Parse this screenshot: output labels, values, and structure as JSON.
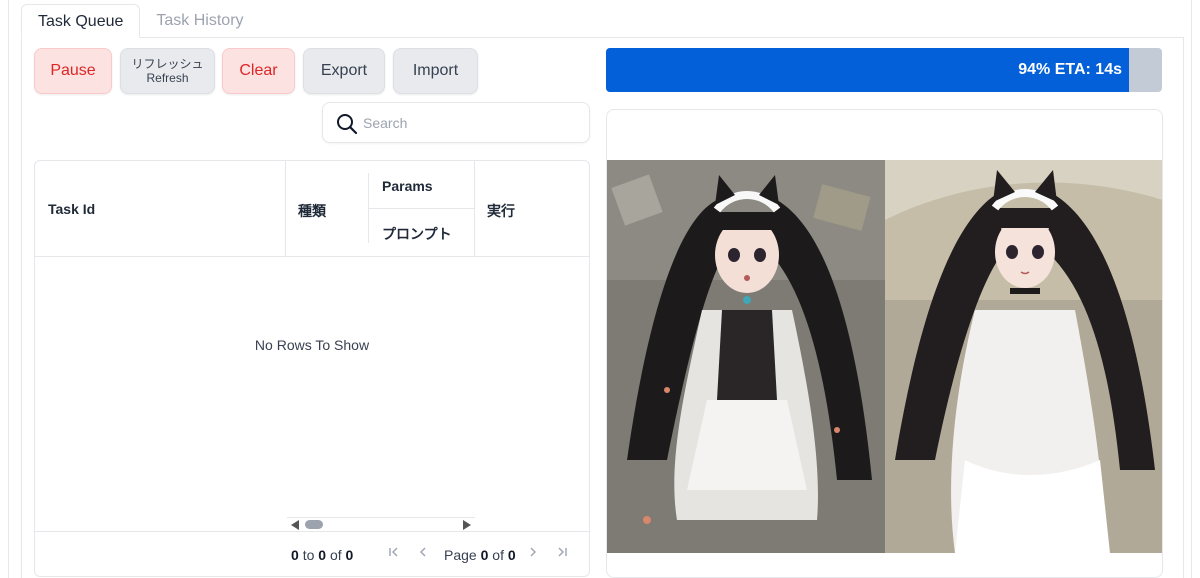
{
  "tabs": [
    {
      "label": "Task Queue",
      "active": true
    },
    {
      "label": "Task History",
      "active": false
    }
  ],
  "toolbar": {
    "pause_label": "Pause",
    "refresh_label_jp": "リフレッシュ",
    "refresh_label_en": "Refresh",
    "clear_label": "Clear",
    "export_label": "Export",
    "import_label": "Import"
  },
  "search": {
    "placeholder": "Search",
    "value": ""
  },
  "grid": {
    "columns": {
      "task_id": "Task Id",
      "type": "種類",
      "params_group": "Params",
      "prompt": "プロンプト",
      "execute": "実行"
    },
    "empty_message": "No Rows To Show",
    "pagination": {
      "row_from": "0",
      "to_word": "to",
      "row_to": "0",
      "of_word": "of",
      "row_total": "0",
      "page_word": "Page",
      "page_current": "0",
      "page_of_word": "of",
      "page_total": "0"
    }
  },
  "progress": {
    "percent": 94,
    "label": "94% ETA: 14s",
    "fill_color": "#0360d8",
    "track_color": "#c3cbd6"
  },
  "gallery": {
    "images": [
      {
        "name": "anime-maid-catgirl-image-1"
      },
      {
        "name": "anime-maid-catgirl-image-2"
      }
    ]
  },
  "colors": {
    "danger_bg": "#fde2e2",
    "danger_text": "#dc2626",
    "secondary_bg": "#e9eaed"
  },
  "icons": [
    "search-icon",
    "first-page-icon",
    "prev-page-icon",
    "next-page-icon",
    "last-page-icon"
  ]
}
